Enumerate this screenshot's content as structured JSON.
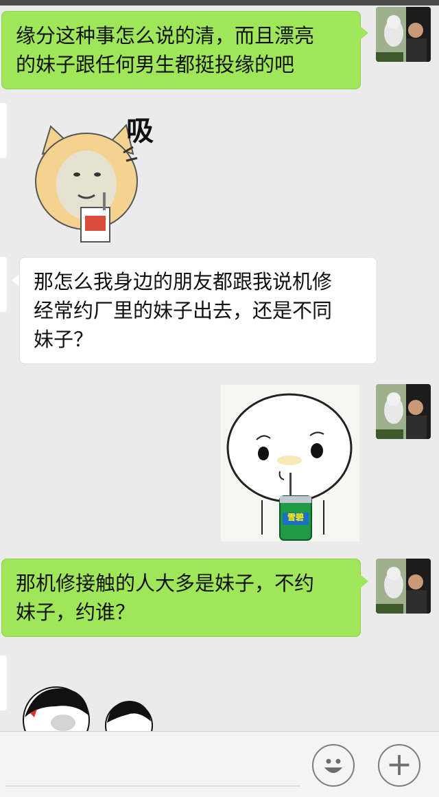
{
  "messages": [
    {
      "side": "right",
      "type": "text",
      "text_lines": [
        "缘分这种事怎么说的清，而且漂亮",
        "的妹子跟任何男生都挺投缘的吧"
      ]
    },
    {
      "side": "left",
      "type": "sticker",
      "sticker": "cat-sipping-drink",
      "caption": "吸"
    },
    {
      "side": "left",
      "type": "text",
      "text_lines": [
        "那怎么我身边的朋友都跟我说机修",
        "经常约厂里的妹子出去，还是不同",
        "妹子？"
      ]
    },
    {
      "side": "right",
      "type": "sticker",
      "sticker": "round-face-drinking-soda",
      "can_label": "雪碧"
    },
    {
      "side": "right",
      "type": "text",
      "text_lines": [
        "那机修接触的人大多是妹子，不约",
        "妹子，约谁？"
      ]
    },
    {
      "side": "left",
      "type": "sticker",
      "sticker": "meme-faces-partial"
    }
  ],
  "input_bar": {
    "emoji_icon": "smiley-face-icon",
    "plus_icon": "plus-icon",
    "plus_label": "+"
  },
  "colors": {
    "background": "#ebebeb",
    "sent_bubble": "#9fe658",
    "received_bubble": "#ffffff",
    "status_bar": "#4a4a4a"
  }
}
